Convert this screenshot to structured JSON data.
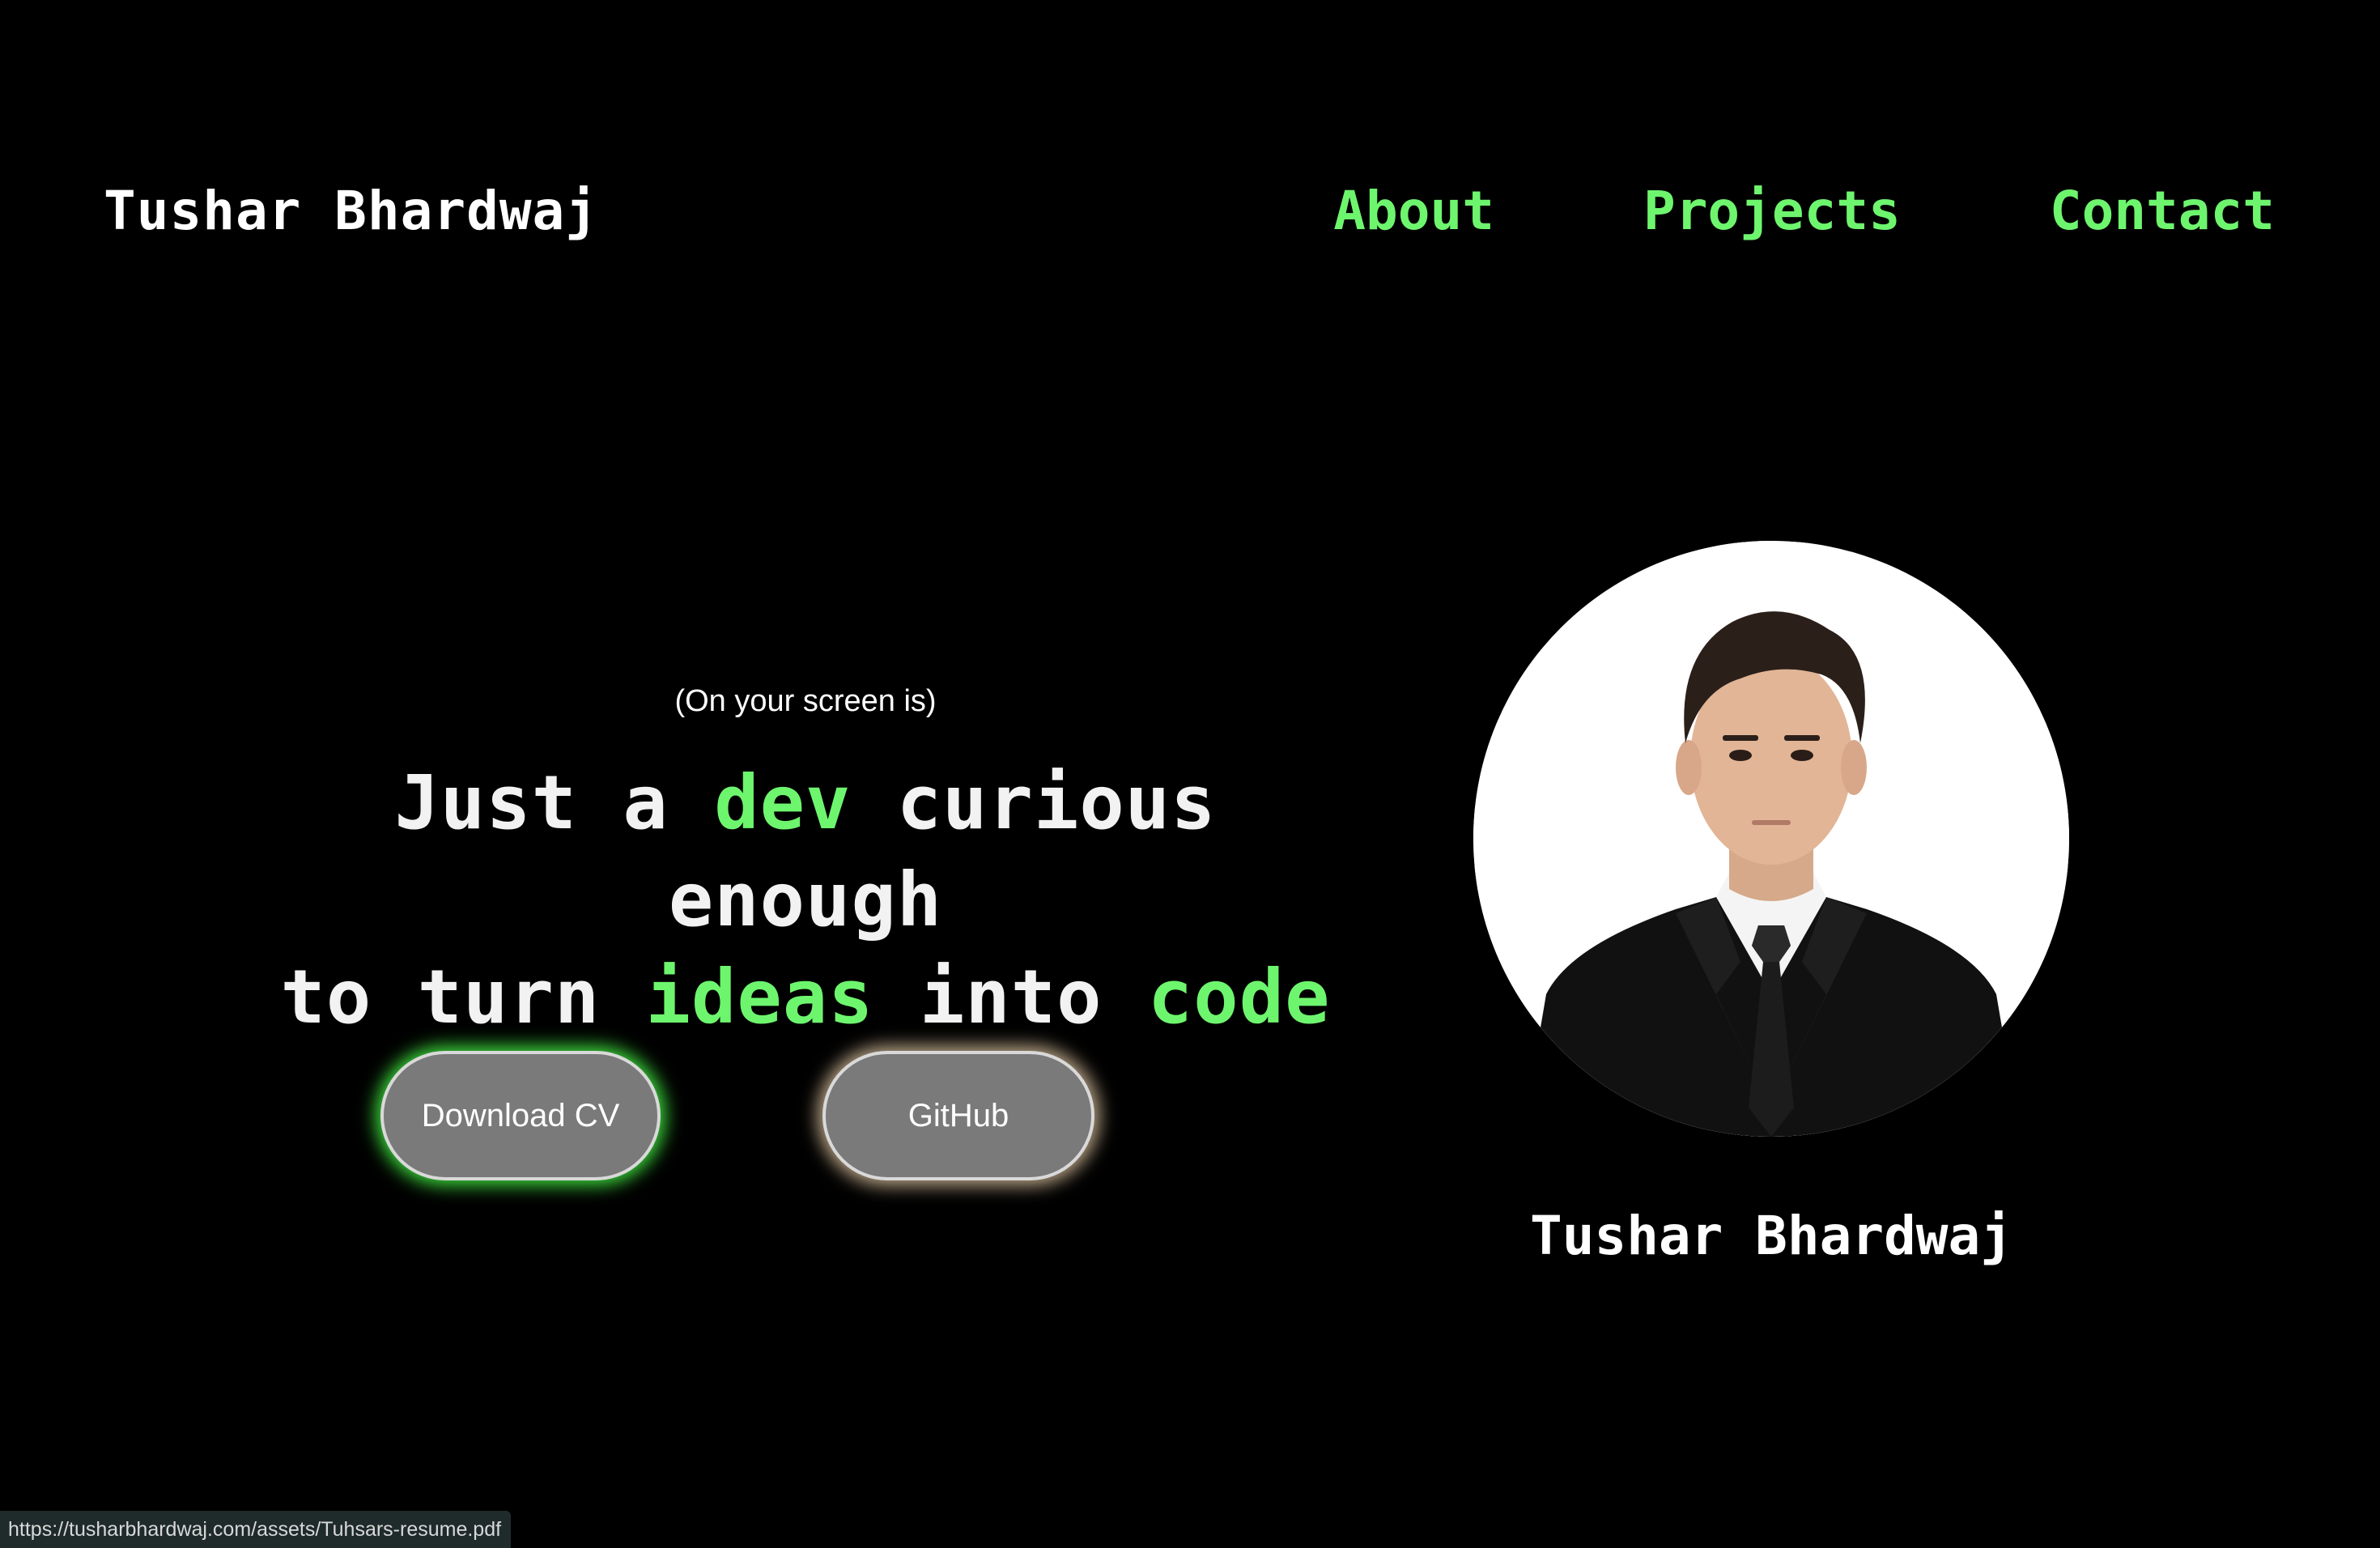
{
  "header": {
    "brand": "Tushar Bhardwaj",
    "nav": [
      "About",
      "Projects",
      "Contact"
    ]
  },
  "hero": {
    "eyebrow": "(On your screen is)",
    "line1": {
      "pre": "Just a ",
      "hl1": "dev",
      "post": " curious enough"
    },
    "line2": {
      "pre": "to turn ",
      "hl1": "ideas",
      "mid": " into ",
      "hl2": "code"
    },
    "buttons": {
      "download": "Download CV",
      "github": "GitHub"
    }
  },
  "profile": {
    "name": "Tushar Bhardwaj"
  },
  "status_bar": {
    "url": "https://tusharbhardwaj.com/assets/Tuhsars-resume.pdf"
  },
  "colors": {
    "background": "#000000",
    "accent": "#6ef56e",
    "button_bg": "#7a7a7a"
  },
  "icons": {
    "profile_photo": "person-portrait"
  }
}
